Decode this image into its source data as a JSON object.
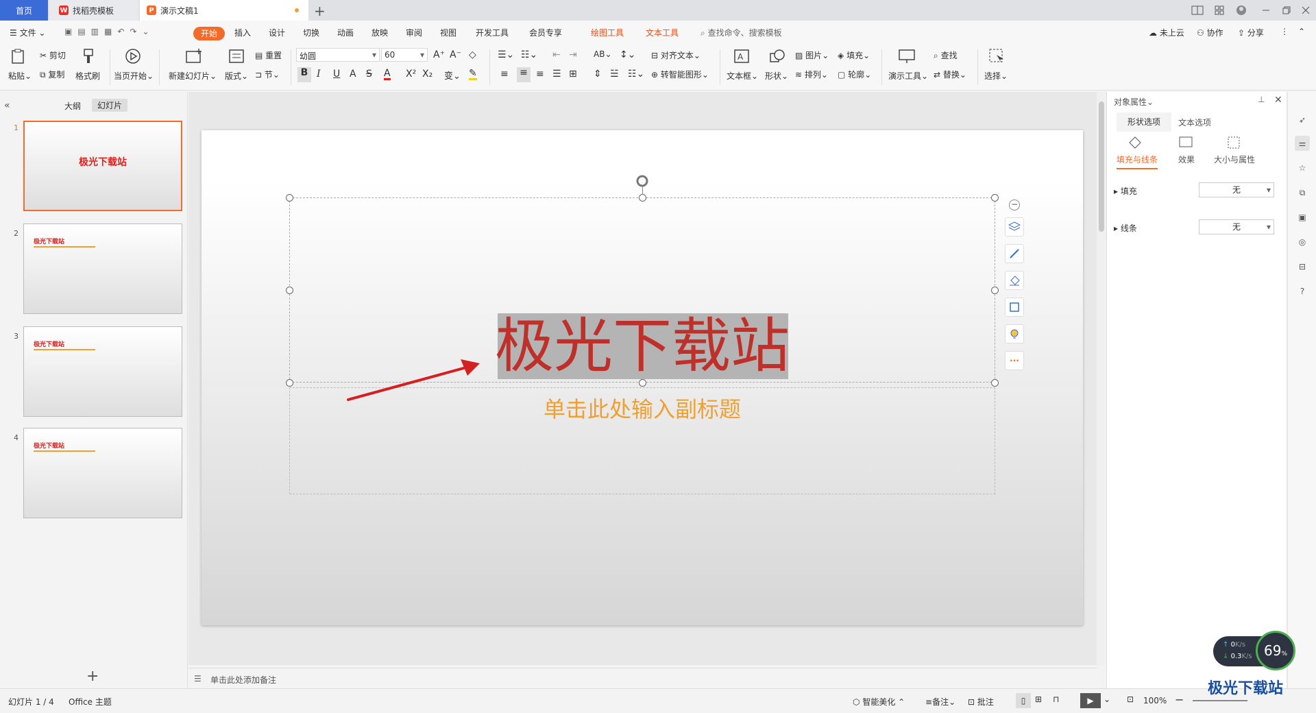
{
  "tabs": {
    "home": "首页",
    "template": "找稻壳模板",
    "doc": "演示文稿1"
  },
  "menu": {
    "file": "文件",
    "items": [
      "开始",
      "插入",
      "设计",
      "切换",
      "动画",
      "放映",
      "审阅",
      "视图",
      "开发工具",
      "会员专享"
    ],
    "drawing_tools": "绘图工具",
    "text_tools": "文本工具",
    "search": "查找命令、搜索模板",
    "cloud": "未上云",
    "collab": "协作",
    "share": "分享"
  },
  "ribbon": {
    "paste": "粘贴",
    "cut": "剪切",
    "copy": "复制",
    "format_painter": "格式刷",
    "from_current": "当页开始",
    "new_slide": "新建幻灯片",
    "layout": "版式",
    "reset": "重置",
    "section": "节",
    "font_name": "幼圆",
    "font_size": "60",
    "align_text": "对齐文本",
    "smart_art": "转智能图形",
    "textbox": "文本框",
    "shape": "形状",
    "picture": "图片",
    "arrange": "排列",
    "fill": "填充",
    "outline": "轮廓",
    "present_tools": "演示工具",
    "find": "查找",
    "replace": "替换",
    "select": "选择"
  },
  "left_panel": {
    "outline_tab": "大纲",
    "slides_tab": "幻灯片",
    "slide_title": "极光下载站"
  },
  "slide": {
    "title": "极光下载站",
    "subtitle": "单击此处输入副标题"
  },
  "notes": {
    "placeholder": "单击此处添加备注"
  },
  "right_panel": {
    "title": "对象属性",
    "tab_shape": "形状选项",
    "tab_text": "文本选项",
    "sub_fill_line": "填充与线条",
    "sub_effect": "效果",
    "sub_size": "大小与属性",
    "fill_label": "填充",
    "fill_value": "无",
    "line_label": "线条",
    "line_value": "无"
  },
  "status": {
    "slide_count": "幻灯片 1 / 4",
    "theme": "Office 主题",
    "beautify": "智能美化",
    "notes": "备注",
    "comment": "批注",
    "zoom": "100%"
  },
  "speed_widget": {
    "up": "0",
    "down": "0.3",
    "unit": "K/s",
    "percent": "69"
  },
  "watermark": "极光下载站",
  "colors": {
    "accent": "#f26b2a",
    "title_red": "#c0302a",
    "subtitle_orange": "#f0a030"
  }
}
